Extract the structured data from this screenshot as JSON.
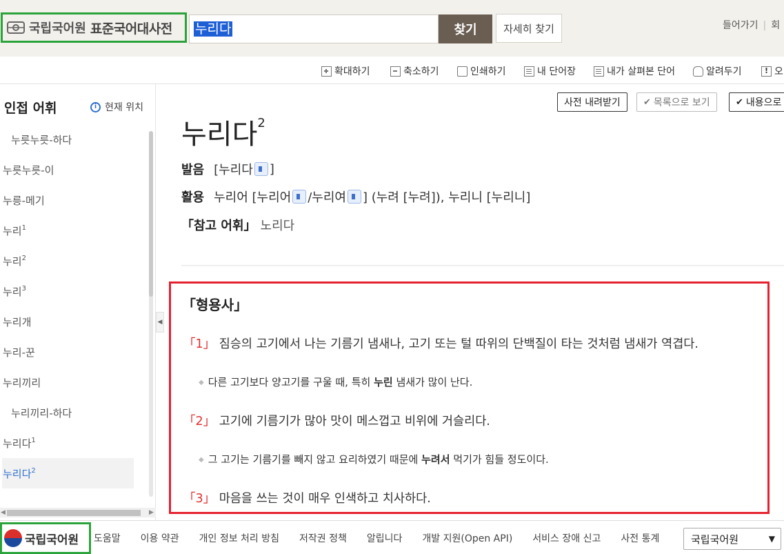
{
  "header": {
    "logo_org": "국립국어원",
    "logo_title": "표준국어대사전",
    "search_value": "누리다",
    "search_button": "찾기",
    "detail_search": "자세히 찾기",
    "links": [
      "들어가기",
      "회"
    ]
  },
  "toolbar": {
    "zoom_in": "확대하기",
    "zoom_out": "축소하기",
    "print": "인쇄하기",
    "my_words": "내 단어장",
    "viewed_words": "내가 살펴본 단어",
    "share": "알려두기",
    "report": "오"
  },
  "sidebar": {
    "title": "인접 어휘",
    "current_location": "현재 위치",
    "items": [
      {
        "label": "누릇누릇-하다",
        "sup": ""
      },
      {
        "label": "누릇누릇-이",
        "sup": ""
      },
      {
        "label": "누릉-메기",
        "sup": ""
      },
      {
        "label": "누리",
        "sup": "1"
      },
      {
        "label": "누리",
        "sup": "2"
      },
      {
        "label": "누리",
        "sup": "3"
      },
      {
        "label": "누리개",
        "sup": ""
      },
      {
        "label": "누리-꾼",
        "sup": ""
      },
      {
        "label": "누리끼리",
        "sup": ""
      },
      {
        "label": "누리끼리-하다",
        "sup": ""
      },
      {
        "label": "누리다",
        "sup": "1"
      },
      {
        "label": "누리다",
        "sup": "2"
      }
    ]
  },
  "entry": {
    "download_button": "사전 내려받기",
    "list_view_button": "목록으로 보기",
    "content_view_button": "내용으로",
    "headword": "누리다",
    "headword_sup": "2",
    "pronunciation_label": "발음",
    "pronunciation": "[누리다",
    "pronunciation_close": "]",
    "conjugation_label": "활용",
    "conj_1": "누리어 [누리어",
    "conj_2": "/누리여",
    "conj_3": "] (누려 [누려]), 누리니 [누리니]",
    "ref_label": "「참고 어휘」",
    "ref_value": "노리다",
    "pos": "「형용사」",
    "senses": [
      {
        "num": "「1」",
        "text": "짐승의 고기에서 나는 기름기 냄새나, 고기 또는 털 따위의 단백질이 타는 것처럼 냄새가 역겹다.",
        "example_pre": "다른 고기보다 양고기를 구울 때, 특히 ",
        "example_bold": "누린",
        "example_post": " 냄새가 많이 난다."
      },
      {
        "num": "「2」",
        "text": "고기에 기름기가 많아 맛이 메스껍고 비위에 거슬리다.",
        "example_pre": "그 고기는 기름기를 빼지 않고 요리하였기 때문에 ",
        "example_bold": "누려서",
        "example_post": " 먹기가 힘들 정도이다."
      },
      {
        "num": "「3」",
        "text": "마음을 쓰는 것이 매우 인색하고 치사하다."
      }
    ]
  },
  "footer": {
    "org": "국립국어원",
    "links": [
      "도움말",
      "이용 약관",
      "개인 정보 처리 방침",
      "저작권 정책",
      "알립니다",
      "개발 지원(Open API)",
      "서비스 장애 신고",
      "사전 통계"
    ],
    "select_value": "국립국어원"
  },
  "colors": {
    "accent_green": "#2aa33a",
    "accent_red": "#e5202e",
    "link_blue": "#2f6fd1",
    "search_button_bg": "#6a5e52"
  }
}
